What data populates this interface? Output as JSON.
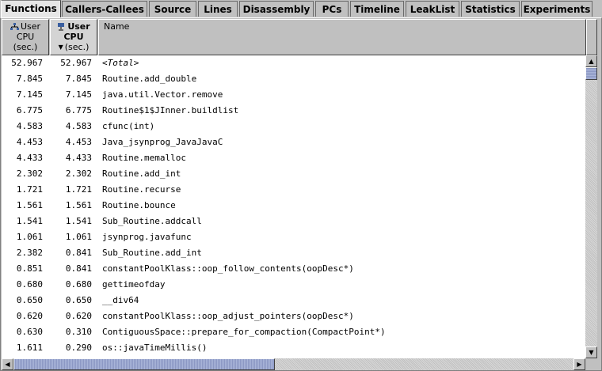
{
  "tabs": [
    {
      "label": "Functions",
      "active": true
    },
    {
      "label": "Callers-Callees",
      "active": false
    },
    {
      "label": "Source",
      "active": false
    },
    {
      "label": "Lines",
      "active": false
    },
    {
      "label": "Disassembly",
      "active": false
    },
    {
      "label": "PCs",
      "active": false
    },
    {
      "label": "Timeline",
      "active": false
    },
    {
      "label": "LeakList",
      "active": false
    },
    {
      "label": "Statistics",
      "active": false
    },
    {
      "label": "Experiments",
      "active": false
    }
  ],
  "columns": {
    "inclusive": {
      "line1": "User",
      "line2": "CPU",
      "line3": "(sec.)",
      "icon": "inclusive-metric-icon"
    },
    "exclusive": {
      "line1": "User",
      "line2": "CPU",
      "line3": "(sec.)",
      "icon": "exclusive-metric-icon",
      "sort_icon": "sort-descending-icon"
    },
    "name": {
      "label": "Name"
    }
  },
  "rows": [
    {
      "incl": "52.967",
      "excl": "52.967",
      "name": "<Total>"
    },
    {
      "incl": "7.845",
      "excl": "7.845",
      "name": "Routine.add_double"
    },
    {
      "incl": "7.145",
      "excl": "7.145",
      "name": "java.util.Vector.remove"
    },
    {
      "incl": "6.775",
      "excl": "6.775",
      "name": "Routine$1$JInner.buildlist"
    },
    {
      "incl": "4.583",
      "excl": "4.583",
      "name": "cfunc(int)"
    },
    {
      "incl": "4.453",
      "excl": "4.453",
      "name": "Java_jsynprog_JavaJavaC"
    },
    {
      "incl": "4.433",
      "excl": "4.433",
      "name": "Routine.memalloc"
    },
    {
      "incl": "2.302",
      "excl": "2.302",
      "name": "Routine.add_int"
    },
    {
      "incl": "1.721",
      "excl": "1.721",
      "name": "Routine.recurse"
    },
    {
      "incl": "1.561",
      "excl": "1.561",
      "name": "Routine.bounce"
    },
    {
      "incl": "1.541",
      "excl": "1.541",
      "name": "Sub_Routine.addcall"
    },
    {
      "incl": "1.061",
      "excl": "1.061",
      "name": "jsynprog.javafunc"
    },
    {
      "incl": "2.382",
      "excl": "0.841",
      "name": "Sub_Routine.add_int"
    },
    {
      "incl": "0.851",
      "excl": "0.841",
      "name": "constantPoolKlass::oop_follow_contents(oopDesc*)"
    },
    {
      "incl": "0.680",
      "excl": "0.680",
      "name": "gettimeofday"
    },
    {
      "incl": "0.650",
      "excl": "0.650",
      "name": "__div64"
    },
    {
      "incl": "0.620",
      "excl": "0.620",
      "name": "constantPoolKlass::oop_adjust_pointers(oopDesc*)"
    },
    {
      "incl": "0.630",
      "excl": "0.310",
      "name": "ContiguousSpace::prepare_for_compaction(CompactPoint*)"
    },
    {
      "incl": "1.611",
      "excl": "0.290",
      "name": "os::javaTimeMillis()"
    }
  ],
  "scrollbars": {
    "up_icon": "scroll-up-icon",
    "down_icon": "scroll-down-icon",
    "left_icon": "scroll-left-icon",
    "right_icon": "scroll-right-icon"
  },
  "glyphs": {
    "up": "▲",
    "down": "▼",
    "left": "◀",
    "right": "▶",
    "sort_desc": "▼"
  }
}
